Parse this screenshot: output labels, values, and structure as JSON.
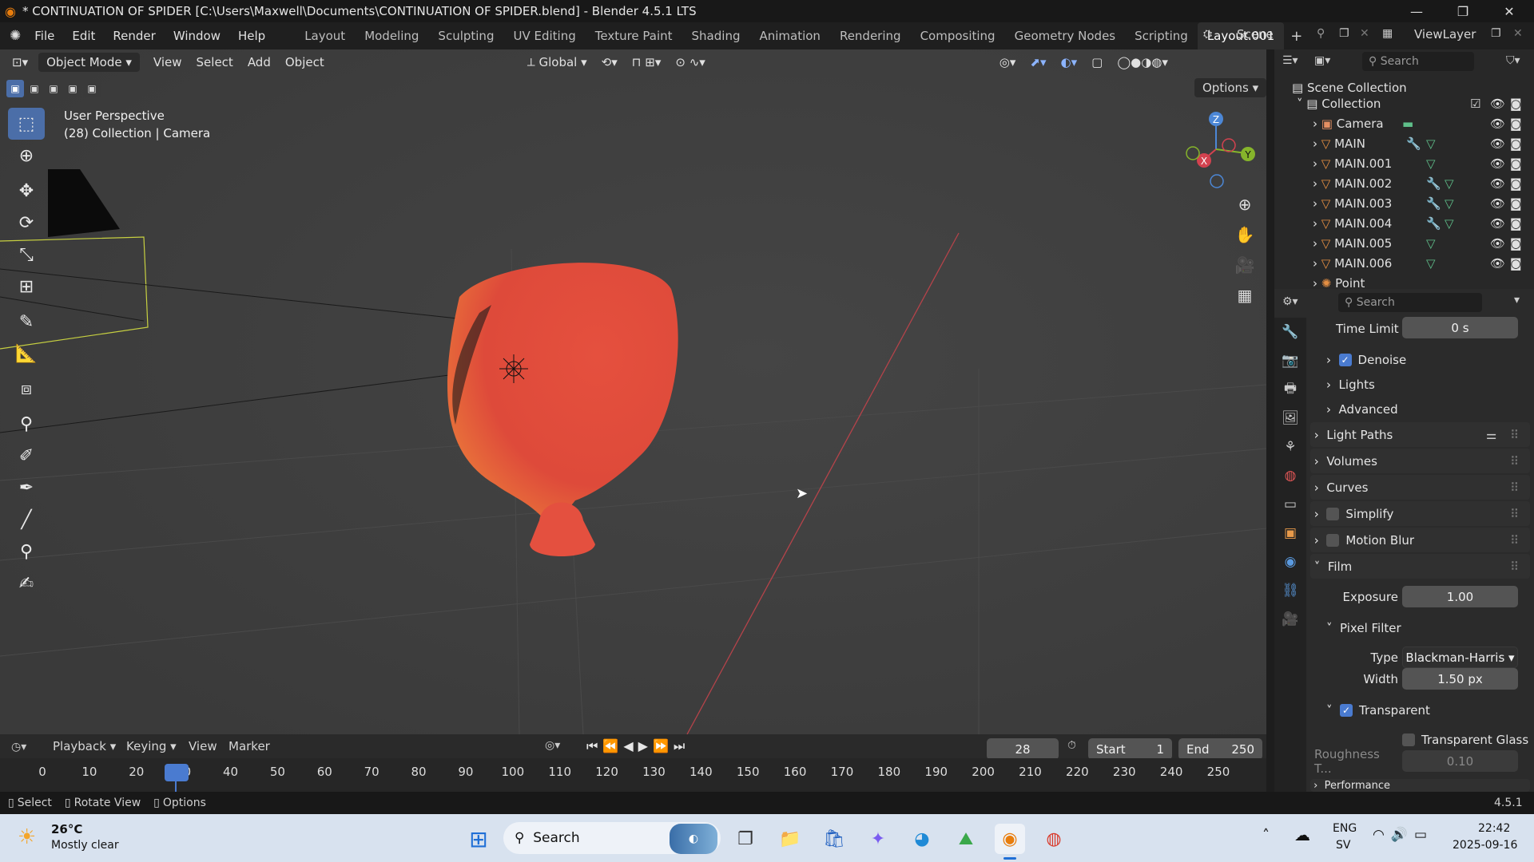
{
  "window": {
    "title": "* CONTINUATION OF SPIDER [C:\\Users\\Maxwell\\Documents\\CONTINUATION OF SPIDER.blend] - Blender 4.5.1 LTS",
    "minimize": "—",
    "maximize": "❐",
    "close": "✕"
  },
  "menu": {
    "file": "File",
    "edit": "Edit",
    "render": "Render",
    "window": "Window",
    "help": "Help"
  },
  "workspaces": [
    "Layout",
    "Modeling",
    "Sculpting",
    "UV Editing",
    "Texture Paint",
    "Shading",
    "Animation",
    "Rendering",
    "Compositing",
    "Geometry Nodes",
    "Scripting",
    "Layout.001"
  ],
  "scene": {
    "name": "Scene",
    "view_layer": "ViewLayer"
  },
  "viewport": {
    "mode": "Object Mode",
    "view": "View",
    "select": "Select",
    "add": "Add",
    "object": "Object",
    "transform": "Global",
    "options": "Options",
    "perspective": "User Perspective",
    "info": "(28) Collection | Camera",
    "gizmo": {
      "z": "Z",
      "x": "X",
      "y": "Y"
    }
  },
  "outliner": {
    "search_placeholder": "Search",
    "scene_collection": "Scene Collection",
    "collection": "Collection",
    "items": [
      "Camera",
      "MAIN",
      "MAIN.001",
      "MAIN.002",
      "MAIN.003",
      "MAIN.004",
      "MAIN.005",
      "MAIN.006",
      "Point"
    ]
  },
  "properties": {
    "search_placeholder": "Search",
    "time_limit_label": "Time Limit",
    "time_limit": "0 s",
    "denoise": "Denoise",
    "lights": "Lights",
    "advanced": "Advanced",
    "light_paths": "Light Paths",
    "volumes": "Volumes",
    "curves": "Curves",
    "simplify": "Simplify",
    "motion_blur": "Motion Blur",
    "film": "Film",
    "exposure_label": "Exposure",
    "exposure": "1.00",
    "pixel_filter": "Pixel Filter",
    "type_label": "Type",
    "type": "Blackman-Harris",
    "width_label": "Width",
    "width": "1.50 px",
    "transparent": "Transparent",
    "transparent_glass": "Transparent Glass",
    "roughness_label": "Roughness T...",
    "roughness": "0.10",
    "performance": "Performance"
  },
  "timeline": {
    "playback": "Playback",
    "keying": "Keying",
    "view": "View",
    "marker": "Marker",
    "current_frame": "28",
    "start_label": "Start",
    "start": "1",
    "end_label": "End",
    "end": "250",
    "ticks": [
      "0",
      "10",
      "20",
      "30",
      "40",
      "50",
      "60",
      "70",
      "80",
      "90",
      "100",
      "110",
      "120",
      "130",
      "140",
      "150",
      "160",
      "170",
      "180",
      "190",
      "200",
      "210",
      "220",
      "230",
      "240",
      "250"
    ]
  },
  "status": {
    "select": "Select",
    "rotate": "Rotate View",
    "options": "Options",
    "version": "4.5.1"
  },
  "taskbar": {
    "weather_temp": "26°C",
    "weather_desc": "Mostly clear",
    "search": "Search",
    "lang1": "ENG",
    "lang2": "SV",
    "time": "22:42",
    "date": "2025-09-16"
  }
}
